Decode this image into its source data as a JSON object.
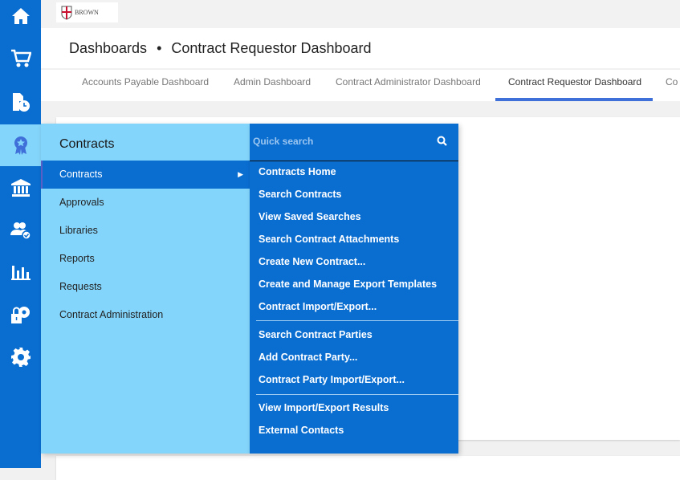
{
  "sidebar": {
    "icons": [
      "home-icon",
      "cart-icon",
      "document-clock-icon",
      "award-icon",
      "bank-icon",
      "users-check-icon",
      "bar-chart-icon",
      "lock-gear-icon",
      "gear-icon"
    ],
    "active": "award-icon"
  },
  "logo": {
    "text": "BROWN"
  },
  "header": {
    "crumb": "Dashboards",
    "separator": "•",
    "title": "Contract Requestor Dashboard"
  },
  "tabs": [
    {
      "label": "Accounts Payable Dashboard"
    },
    {
      "label": "Admin Dashboard"
    },
    {
      "label": "Contract Administrator Dashboard"
    },
    {
      "label": "Contract Requestor Dashboard",
      "active": true
    },
    {
      "label": "Co"
    }
  ],
  "menu": {
    "title": "Contracts",
    "items": [
      {
        "label": "Contracts",
        "selected": true
      },
      {
        "label": "Approvals"
      },
      {
        "label": "Libraries"
      },
      {
        "label": "Reports"
      },
      {
        "label": "Requests"
      },
      {
        "label": "Contract Administration"
      }
    ],
    "search_placeholder": "Quick search",
    "submenu": [
      [
        "Contracts Home",
        "Search Contracts",
        "View Saved Searches",
        "Search Contract Attachments",
        "Create New Contract...",
        "Create and Manage Export Templates",
        "Contract Import/Export..."
      ],
      [
        "Search Contract Parties",
        "Add Contract Party...",
        "Contract Party Import/Export..."
      ],
      [
        "View Import/Export Results",
        "External Contacts"
      ]
    ]
  },
  "colors": {
    "brand_blue": "#0a6ed1",
    "menu_light": "#84d5fb",
    "tab_accent": "#3f6fd8"
  }
}
